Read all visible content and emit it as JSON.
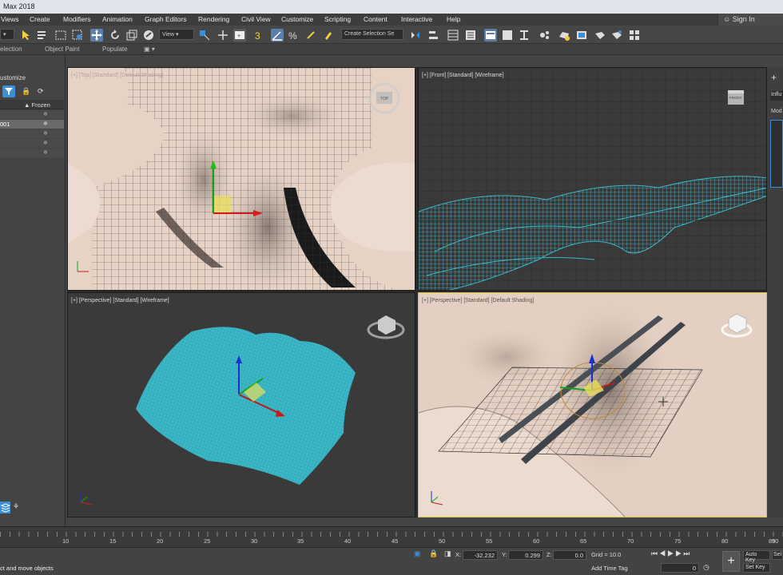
{
  "window": {
    "title": "Max 2018"
  },
  "menu": {
    "items": [
      "Views",
      "Create",
      "Modifiers",
      "Animation",
      "Graph Editors",
      "Rendering",
      "Civil View",
      "Customize",
      "Scripting",
      "Content",
      "Interactive",
      "Help"
    ],
    "signin": "Sign In"
  },
  "toolbar": {
    "view_dropdown": "View",
    "selection_set": "Create Selection Se"
  },
  "ribbon": {
    "tabs": [
      "election",
      "Object Paint",
      "Populate"
    ]
  },
  "scene_explorer": {
    "title": "ustomize",
    "column_frozen": "Frozen",
    "rows": [
      "001",
      "",
      "",
      ""
    ]
  },
  "viewports": {
    "top_left": "[+] [Top] [Standard] [Default Shading]",
    "top_right": "[+] [Front] [Standard] [Wireframe]",
    "bottom_left": "[+] [Perspective] [Standard] [Wireframe]",
    "bottom_right": "[+] [Perspective] [Standard] [Default Shading]",
    "viewcube_top": "TOP",
    "viewcube_front": "FRONT"
  },
  "right_panel": {
    "labels": [
      "Influ",
      "Mod"
    ]
  },
  "timeline": {
    "ticks": [
      "10",
      "15",
      "20",
      "25",
      "30",
      "35",
      "40",
      "45",
      "50",
      "55",
      "60",
      "65",
      "70",
      "75",
      "80",
      "85",
      "90"
    ]
  },
  "status": {
    "prompt": "ct and move objects",
    "x_label": "X:",
    "x_value": "-32.232",
    "y_label": "Y:",
    "y_value": "0.299",
    "z_label": "Z:",
    "z_value": "0.0",
    "grid": "Grid = 10.0",
    "add_time_tag": "Add Time Tag",
    "frame": "0",
    "auto_key": "Auto Key",
    "set_key": "Set Key",
    "sel": "Sel"
  },
  "colors": {
    "wire": "#3bb8c8",
    "terrain": "#e9d6c8",
    "accent": "#3b8fd6"
  }
}
